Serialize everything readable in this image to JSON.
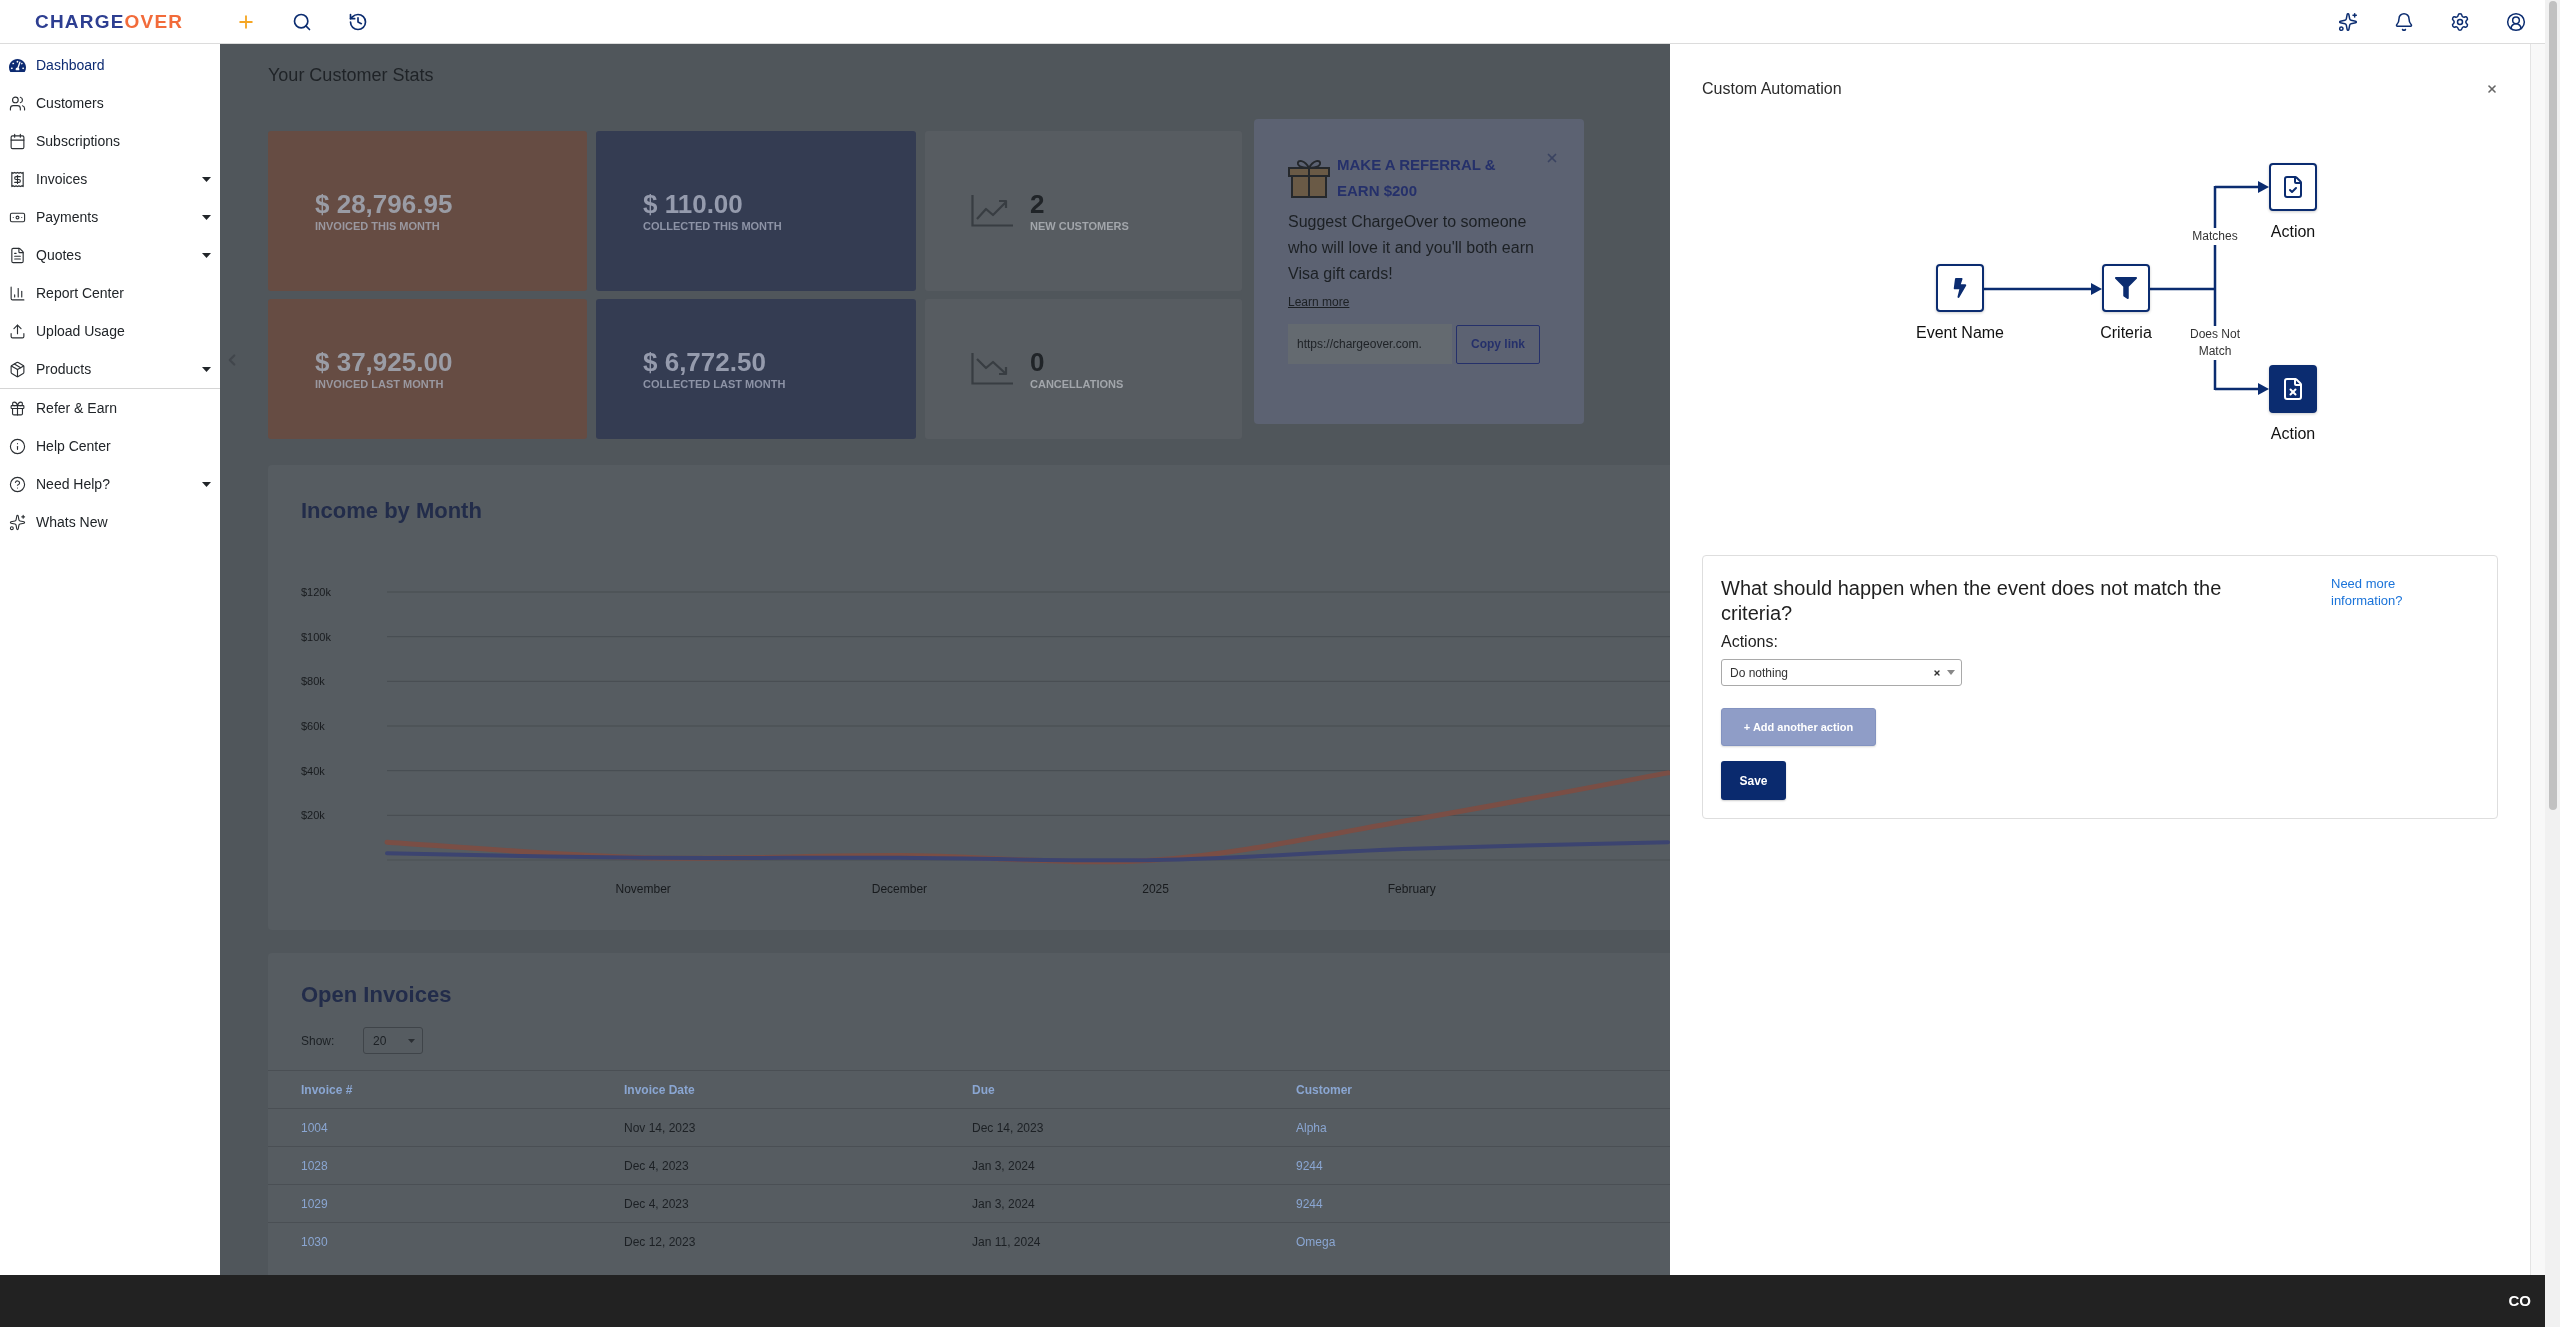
{
  "header": {
    "logo": {
      "part_1": "CHARGE",
      "part_2": "OVER"
    }
  },
  "sidebar": {
    "groups": [
      {
        "items": [
          {
            "kind": "dashboard",
            "label": "Dashboard",
            "selected": true,
            "has_submenu": false
          },
          {
            "kind": "customers",
            "label": "Customers",
            "selected": false,
            "has_submenu": false
          },
          {
            "kind": "subscriptions",
            "label": "Subscriptions",
            "selected": false,
            "has_submenu": false
          },
          {
            "kind": "invoices",
            "label": "Invoices",
            "selected": false,
            "has_submenu": true
          },
          {
            "kind": "payments",
            "label": "Payments",
            "selected": false,
            "has_submenu": true
          },
          {
            "kind": "quotes",
            "label": "Quotes",
            "selected": false,
            "has_submenu": true
          },
          {
            "kind": "reports",
            "label": "Report Center",
            "selected": false,
            "has_submenu": false
          },
          {
            "kind": "usage",
            "label": "Upload Usage",
            "selected": false,
            "has_submenu": false
          },
          {
            "kind": "products",
            "label": "Products",
            "selected": false,
            "has_submenu": true
          }
        ]
      },
      {
        "items": [
          {
            "kind": "referral",
            "label": "Refer & Earn",
            "selected": false,
            "has_submenu": false
          },
          {
            "kind": "help",
            "label": "Help Center",
            "selected": false,
            "has_submenu": false
          },
          {
            "kind": "support",
            "label": "Need Help?",
            "selected": false,
            "has_submenu": true
          },
          {
            "kind": "news",
            "label": "Whats New",
            "selected": false,
            "has_submenu": false
          }
        ]
      }
    ]
  },
  "customer_stats": {
    "title": "Your Customer Stats",
    "cards": [
      {
        "kind": "invoiced",
        "value": "$ 28,796.95",
        "label": "INVOICED THIS MONTH"
      },
      {
        "kind": "collected",
        "value": "$ 110.00",
        "label": "COLLECTED THIS MONTH"
      },
      {
        "kind": "growth",
        "value": "2",
        "label": "NEW CUSTOMERS"
      },
      {
        "kind": "invoiced",
        "value": "$ 37,925.00",
        "label": "INVOICED LAST MONTH"
      },
      {
        "kind": "collected",
        "value": "$ 6,772.50",
        "label": "COLLECTED LAST MONTH"
      },
      {
        "kind": "decline",
        "value": "0",
        "label": "CANCELLATIONS"
      }
    ]
  },
  "referral": {
    "title": "MAKE A REFERRAL & EARN $200",
    "text": "Suggest ChargeOver to someone who will love it and you'll both earn Visa gift cards!",
    "link": "Learn more",
    "url_field": {
      "value": "https://chargeover.com."
    },
    "copy_button": "Copy link"
  },
  "income_chart": {
    "chart_data": {
      "type": "line",
      "title": "Income by Month",
      "categories": [
        null,
        "November",
        "December",
        "2025",
        "February",
        null
      ],
      "grid": true,
      "ylim": [
        0,
        120000
      ],
      "yticks": [
        {
          "value": 20000,
          "label": "$20k"
        },
        {
          "value": 40000,
          "label": "$40k"
        },
        {
          "value": 60000,
          "label": "$60k"
        },
        {
          "value": 80000,
          "label": "$80k"
        },
        {
          "value": 100000,
          "label": "$100k"
        },
        {
          "value": 120000,
          "label": "$120k"
        }
      ],
      "series": [
        {
          "color": "#7a4e45",
          "values": [
            8000,
            1000,
            2000,
            0,
            18000,
            39000
          ]
        },
        {
          "color": "#3c4470",
          "values": [
            3000,
            1000,
            1000,
            0,
            5000,
            8000
          ]
        }
      ]
    }
  },
  "open_invoices": {
    "title": "Open Invoices",
    "show_label": "Show:",
    "page_size": "20",
    "columns": [
      "Invoice #",
      "Invoice Date",
      "Due",
      "Customer"
    ],
    "rows": [
      {
        "invoice": "1004",
        "invoice_date": "Nov 14, 2023",
        "due": "Dec 14, 2023",
        "customer": "Alpha"
      },
      {
        "invoice": "1028",
        "invoice_date": "Dec 4, 2023",
        "due": "Jan 3, 2024",
        "customer": "9244"
      },
      {
        "invoice": "1029",
        "invoice_date": "Dec 4, 2023",
        "due": "Jan 3, 2024",
        "customer": "9244"
      },
      {
        "invoice": "1030",
        "invoice_date": "Dec 12, 2023",
        "due": "Jan 11, 2024",
        "customer": "Omega"
      }
    ]
  },
  "panel": {
    "title": "Custom Automation",
    "diagram": {
      "nodes": [
        {
          "kind": "event",
          "label": "Event Name",
          "selected": false
        },
        {
          "kind": "criteria",
          "label": "Criteria",
          "selected": false
        },
        {
          "kind": "accept",
          "label": "Action",
          "selected": false
        },
        {
          "kind": "reject",
          "label": "Action",
          "selected": true
        }
      ],
      "branches": [
        {
          "label": "Matches"
        },
        {
          "label": "Does Not Match"
        }
      ]
    },
    "form": {
      "question": "What should happen when the event does not match the criteria?",
      "help_link": "Need more information?",
      "actions_label": "Actions:",
      "action_select": {
        "value": "Do nothing"
      },
      "add_button": "+ Add another action",
      "save_button": "Save"
    }
  },
  "footer": {
    "logo": "CO"
  }
}
